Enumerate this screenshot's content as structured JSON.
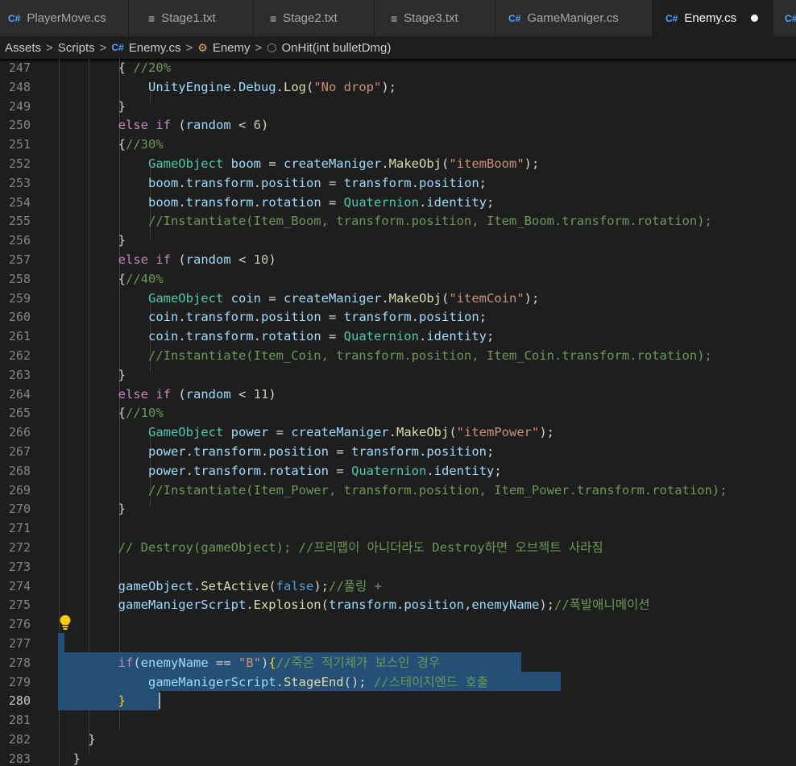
{
  "tabs": [
    {
      "label": "PlayerMove.cs",
      "icon": "csharp-file-icon"
    },
    {
      "label": "Stage1.txt",
      "icon": "text-file-icon"
    },
    {
      "label": "Stage2.txt",
      "icon": "text-file-icon"
    },
    {
      "label": "Stage3.txt",
      "icon": "text-file-icon"
    },
    {
      "label": "GameManiger.cs",
      "icon": "csharp-file-icon"
    },
    {
      "label": "Enemy.cs",
      "icon": "csharp-file-icon",
      "active": true,
      "modified": true
    }
  ],
  "breadcrumb": {
    "items": [
      "Assets",
      "Scripts",
      "Enemy.cs",
      "Enemy",
      "OnHit(int bulletDmg)"
    ]
  },
  "editor": {
    "current_line": 280,
    "lines": [
      {
        "n": "247",
        "tokens": [
          [
            "pu",
            "        { "
          ],
          [
            "cm",
            "//20%"
          ]
        ]
      },
      {
        "n": "248",
        "tokens": [
          [
            "pu",
            "            "
          ],
          [
            "var",
            "UnityEngine"
          ],
          [
            "pu",
            "."
          ],
          [
            "var",
            "Debug"
          ],
          [
            "pu",
            "."
          ],
          [
            "fn",
            "Log"
          ],
          [
            "pu",
            "("
          ],
          [
            "st",
            "\"No drop\""
          ],
          [
            "pu",
            ");"
          ]
        ]
      },
      {
        "n": "249",
        "tokens": [
          [
            "pu",
            "        }"
          ]
        ]
      },
      {
        "n": "250",
        "tokens": [
          [
            "pu",
            "        "
          ],
          [
            "ctl",
            "else"
          ],
          [
            "pu",
            " "
          ],
          [
            "ctl",
            "if"
          ],
          [
            "pu",
            " ("
          ],
          [
            "var",
            "random"
          ],
          [
            "pu",
            " < "
          ],
          [
            "nu",
            "6"
          ],
          [
            "pu",
            ")"
          ]
        ]
      },
      {
        "n": "251",
        "tokens": [
          [
            "pu",
            "        {"
          ],
          [
            "cm",
            "//30%"
          ]
        ]
      },
      {
        "n": "252",
        "tokens": [
          [
            "pu",
            "            "
          ],
          [
            "ty",
            "GameObject"
          ],
          [
            "pu",
            " "
          ],
          [
            "var",
            "boom"
          ],
          [
            "pu",
            " = "
          ],
          [
            "var",
            "createManiger"
          ],
          [
            "pu",
            "."
          ],
          [
            "fn",
            "MakeObj"
          ],
          [
            "pu",
            "("
          ],
          [
            "st",
            "\"itemBoom\""
          ],
          [
            "pu",
            ");"
          ]
        ]
      },
      {
        "n": "253",
        "tokens": [
          [
            "pu",
            "            "
          ],
          [
            "var",
            "boom"
          ],
          [
            "pu",
            "."
          ],
          [
            "var",
            "transform"
          ],
          [
            "pu",
            "."
          ],
          [
            "var",
            "position"
          ],
          [
            "pu",
            " = "
          ],
          [
            "var",
            "transform"
          ],
          [
            "pu",
            "."
          ],
          [
            "var",
            "position"
          ],
          [
            "pu",
            ";"
          ]
        ]
      },
      {
        "n": "254",
        "tokens": [
          [
            "pu",
            "            "
          ],
          [
            "var",
            "boom"
          ],
          [
            "pu",
            "."
          ],
          [
            "var",
            "transform"
          ],
          [
            "pu",
            "."
          ],
          [
            "var",
            "rotation"
          ],
          [
            "pu",
            " = "
          ],
          [
            "ty",
            "Quaternion"
          ],
          [
            "pu",
            "."
          ],
          [
            "var",
            "identity"
          ],
          [
            "pu",
            ";"
          ]
        ]
      },
      {
        "n": "255",
        "tokens": [
          [
            "pu",
            "            "
          ],
          [
            "cm",
            "//Instantiate(Item_Boom, transform.position, Item_Boom.transform.rotation);"
          ]
        ]
      },
      {
        "n": "256",
        "tokens": [
          [
            "pu",
            "        }"
          ]
        ]
      },
      {
        "n": "257",
        "tokens": [
          [
            "pu",
            "        "
          ],
          [
            "ctl",
            "else"
          ],
          [
            "pu",
            " "
          ],
          [
            "ctl",
            "if"
          ],
          [
            "pu",
            " ("
          ],
          [
            "var",
            "random"
          ],
          [
            "pu",
            " < "
          ],
          [
            "nu",
            "10"
          ],
          [
            "pu",
            ")"
          ]
        ]
      },
      {
        "n": "258",
        "tokens": [
          [
            "pu",
            "        {"
          ],
          [
            "cm",
            "//40%"
          ]
        ]
      },
      {
        "n": "259",
        "tokens": [
          [
            "pu",
            "            "
          ],
          [
            "ty",
            "GameObject"
          ],
          [
            "pu",
            " "
          ],
          [
            "var",
            "coin"
          ],
          [
            "pu",
            " = "
          ],
          [
            "var",
            "createManiger"
          ],
          [
            "pu",
            "."
          ],
          [
            "fn",
            "MakeObj"
          ],
          [
            "pu",
            "("
          ],
          [
            "st",
            "\"itemCoin\""
          ],
          [
            "pu",
            ");"
          ]
        ]
      },
      {
        "n": "260",
        "tokens": [
          [
            "pu",
            "            "
          ],
          [
            "var",
            "coin"
          ],
          [
            "pu",
            "."
          ],
          [
            "var",
            "transform"
          ],
          [
            "pu",
            "."
          ],
          [
            "var",
            "position"
          ],
          [
            "pu",
            " = "
          ],
          [
            "var",
            "transform"
          ],
          [
            "pu",
            "."
          ],
          [
            "var",
            "position"
          ],
          [
            "pu",
            ";"
          ]
        ]
      },
      {
        "n": "261",
        "tokens": [
          [
            "pu",
            "            "
          ],
          [
            "var",
            "coin"
          ],
          [
            "pu",
            "."
          ],
          [
            "var",
            "transform"
          ],
          [
            "pu",
            "."
          ],
          [
            "var",
            "rotation"
          ],
          [
            "pu",
            " = "
          ],
          [
            "ty",
            "Quaternion"
          ],
          [
            "pu",
            "."
          ],
          [
            "var",
            "identity"
          ],
          [
            "pu",
            ";"
          ]
        ]
      },
      {
        "n": "262",
        "tokens": [
          [
            "pu",
            "            "
          ],
          [
            "cm",
            "//Instantiate(Item_Coin, transform.position, Item_Coin.transform.rotation);"
          ]
        ]
      },
      {
        "n": "263",
        "tokens": [
          [
            "pu",
            "        }"
          ]
        ]
      },
      {
        "n": "264",
        "tokens": [
          [
            "pu",
            "        "
          ],
          [
            "ctl",
            "else"
          ],
          [
            "pu",
            " "
          ],
          [
            "ctl",
            "if"
          ],
          [
            "pu",
            " ("
          ],
          [
            "var",
            "random"
          ],
          [
            "pu",
            " < "
          ],
          [
            "nu",
            "11"
          ],
          [
            "pu",
            ")"
          ]
        ]
      },
      {
        "n": "265",
        "tokens": [
          [
            "pu",
            "        {"
          ],
          [
            "cm",
            "//10%"
          ]
        ]
      },
      {
        "n": "266",
        "tokens": [
          [
            "pu",
            "            "
          ],
          [
            "ty",
            "GameObject"
          ],
          [
            "pu",
            " "
          ],
          [
            "var",
            "power"
          ],
          [
            "pu",
            " = "
          ],
          [
            "var",
            "createManiger"
          ],
          [
            "pu",
            "."
          ],
          [
            "fn",
            "MakeObj"
          ],
          [
            "pu",
            "("
          ],
          [
            "st",
            "\"itemPower\""
          ],
          [
            "pu",
            ");"
          ]
        ]
      },
      {
        "n": "267",
        "tokens": [
          [
            "pu",
            "            "
          ],
          [
            "var",
            "power"
          ],
          [
            "pu",
            "."
          ],
          [
            "var",
            "transform"
          ],
          [
            "pu",
            "."
          ],
          [
            "var",
            "position"
          ],
          [
            "pu",
            " = "
          ],
          [
            "var",
            "transform"
          ],
          [
            "pu",
            "."
          ],
          [
            "var",
            "position"
          ],
          [
            "pu",
            ";"
          ]
        ]
      },
      {
        "n": "268",
        "tokens": [
          [
            "pu",
            "            "
          ],
          [
            "var",
            "power"
          ],
          [
            "pu",
            "."
          ],
          [
            "var",
            "transform"
          ],
          [
            "pu",
            "."
          ],
          [
            "var",
            "rotation"
          ],
          [
            "pu",
            " = "
          ],
          [
            "ty",
            "Quaternion"
          ],
          [
            "pu",
            "."
          ],
          [
            "var",
            "identity"
          ],
          [
            "pu",
            ";"
          ]
        ]
      },
      {
        "n": "269",
        "tokens": [
          [
            "pu",
            "            "
          ],
          [
            "cm",
            "//Instantiate(Item_Power, transform.position, Item_Power.transform.rotation);"
          ]
        ]
      },
      {
        "n": "270",
        "tokens": [
          [
            "pu",
            "        }"
          ]
        ]
      },
      {
        "n": "271",
        "tokens": []
      },
      {
        "n": "272",
        "tokens": [
          [
            "pu",
            "        "
          ],
          [
            "cm",
            "// Destroy(gameObject); //프리팹이 아니더라도 Destroy하면 오브젝트 사라짐"
          ]
        ]
      },
      {
        "n": "273",
        "tokens": []
      },
      {
        "n": "274",
        "tokens": [
          [
            "pu",
            "        "
          ],
          [
            "var",
            "gameObject"
          ],
          [
            "pu",
            "."
          ],
          [
            "fn",
            "SetActive"
          ],
          [
            "pu",
            "("
          ],
          [
            "kw",
            "false"
          ],
          [
            "pu",
            ");"
          ],
          [
            "cm",
            "//풀링 +"
          ]
        ]
      },
      {
        "n": "275",
        "tokens": [
          [
            "pu",
            "        "
          ],
          [
            "var",
            "gameManigerScript"
          ],
          [
            "pu",
            "."
          ],
          [
            "fn",
            "Explosion"
          ],
          [
            "pu",
            "("
          ],
          [
            "var",
            "transform"
          ],
          [
            "pu",
            "."
          ],
          [
            "var",
            "position"
          ],
          [
            "pu",
            ","
          ],
          [
            "var",
            "enemyName"
          ],
          [
            "pu",
            ");"
          ],
          [
            "cm",
            "//폭발애니메이션"
          ]
        ]
      },
      {
        "n": "276",
        "tokens": []
      },
      {
        "n": "277",
        "tokens": []
      },
      {
        "n": "278",
        "tokens": [
          [
            "pu",
            "        "
          ],
          [
            "ctl",
            "if"
          ],
          [
            "pu",
            "("
          ],
          [
            "var",
            "enemyName"
          ],
          [
            "pu",
            " == "
          ],
          [
            "st",
            "\"B\""
          ],
          [
            "pu",
            ")"
          ],
          [
            "br",
            "{"
          ],
          [
            "cm",
            "//죽은 적기체가 보스인 경우"
          ]
        ]
      },
      {
        "n": "279",
        "tokens": [
          [
            "pu",
            "            "
          ],
          [
            "var",
            "gameManigerScript"
          ],
          [
            "pu",
            "."
          ],
          [
            "fn",
            "StageEnd"
          ],
          [
            "pu",
            "(); "
          ],
          [
            "cm",
            "//스테이지엔드 호출"
          ]
        ]
      },
      {
        "n": "280",
        "tokens": [
          [
            "pu",
            "        "
          ],
          [
            "br",
            "}"
          ]
        ]
      },
      {
        "n": "281",
        "tokens": []
      },
      {
        "n": "282",
        "tokens": [
          [
            "pu",
            "    }"
          ]
        ]
      },
      {
        "n": "283",
        "tokens": [
          [
            "pu",
            "  }"
          ]
        ]
      }
    ]
  },
  "colors": {
    "background": "#1e1e1e",
    "selection": "#264f78",
    "keyword": "#569cd6",
    "control": "#c586c0",
    "type": "#4ec9b0",
    "function": "#dcdcaa",
    "variable": "#9cdcfe",
    "string": "#ce9178",
    "number": "#b5cea8",
    "comment": "#6a9955"
  }
}
